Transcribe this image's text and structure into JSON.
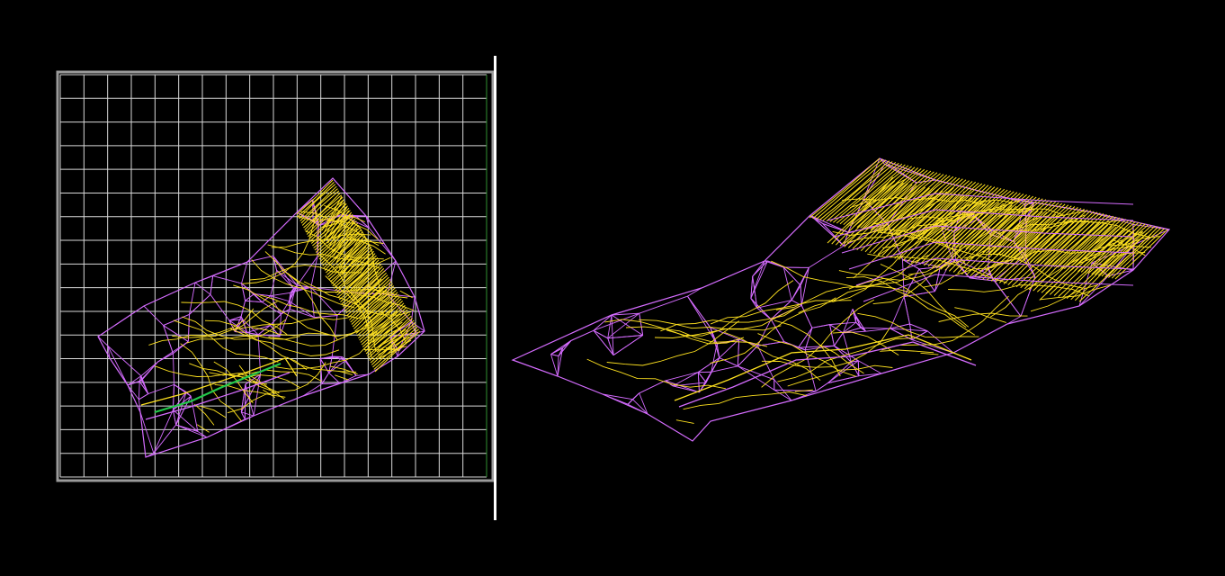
{
  "colors": {
    "background": "#000000",
    "grid_line": "#d8d8d8",
    "grid_frame": "#9a9a9a",
    "frame_right_edge": "#2f8f2f",
    "tin_edge": "#d56cff",
    "contour_line": "#ffe21f",
    "breakline": "#22c94a",
    "divider": "#ffffff"
  },
  "views": {
    "plan": {
      "view": "top",
      "grid": true,
      "grid_columns": 18,
      "grid_rows": 17,
      "frame": true
    },
    "perspective": {
      "view": "3d-oblique",
      "grid": false
    }
  },
  "icons": {
    "plan": "tin-mesh-plan-icon",
    "perspective": "tin-mesh-3d-icon"
  }
}
